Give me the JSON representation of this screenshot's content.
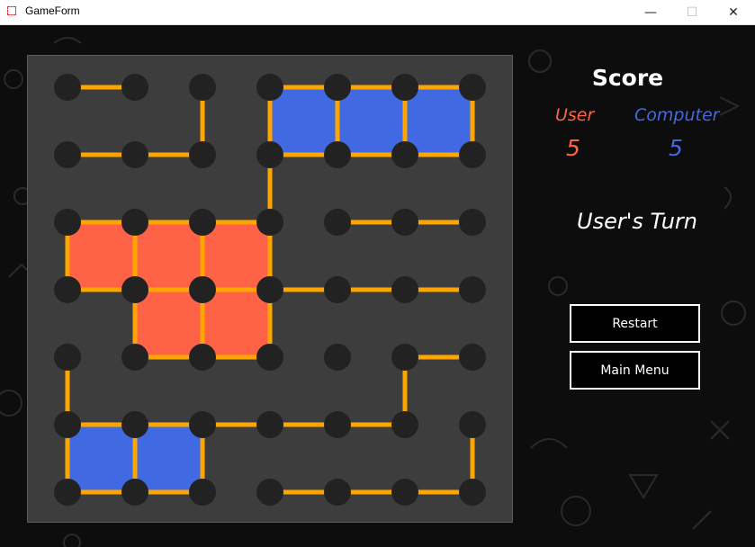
{
  "window": {
    "title": "GameForm",
    "minimize_glyph": "—",
    "maximize_glyph": "☐",
    "close_glyph": "✕"
  },
  "colors": {
    "user": "#ff6347",
    "computer": "#4169e1",
    "line": "#ffa500",
    "dot": "#222222",
    "board": "#3d3d3d"
  },
  "score": {
    "title": "Score",
    "user_label": "User",
    "computer_label": "Computer",
    "user_score": "5",
    "computer_score": "5"
  },
  "turn_text": "User's Turn",
  "buttons": {
    "restart": "Restart",
    "main_menu": "Main Menu"
  },
  "board": {
    "rows": 7,
    "cols": 7,
    "h_lines": [
      [
        0,
        0
      ],
      [
        1,
        0
      ],
      [
        1,
        1
      ],
      [
        0,
        3
      ],
      [
        0,
        4
      ],
      [
        0,
        5
      ],
      [
        1,
        3
      ],
      [
        1,
        4
      ],
      [
        1,
        5
      ],
      [
        2,
        0
      ],
      [
        2,
        1
      ],
      [
        2,
        2
      ],
      [
        2,
        4
      ],
      [
        2,
        5
      ],
      [
        3,
        0
      ],
      [
        3,
        1
      ],
      [
        3,
        2
      ],
      [
        3,
        3
      ],
      [
        3,
        4
      ],
      [
        3,
        5
      ],
      [
        4,
        1
      ],
      [
        4,
        2
      ],
      [
        4,
        5
      ],
      [
        5,
        0
      ],
      [
        5,
        1
      ],
      [
        5,
        2
      ],
      [
        5,
        3
      ],
      [
        5,
        4
      ],
      [
        6,
        0
      ],
      [
        6,
        1
      ],
      [
        6,
        3
      ],
      [
        6,
        4
      ],
      [
        6,
        5
      ]
    ],
    "v_lines": [
      [
        0,
        2
      ],
      [
        0,
        3
      ],
      [
        0,
        4
      ],
      [
        0,
        5
      ],
      [
        0,
        6
      ],
      [
        1,
        3
      ],
      [
        2,
        0
      ],
      [
        2,
        1
      ],
      [
        2,
        2
      ],
      [
        2,
        3
      ],
      [
        3,
        1
      ],
      [
        3,
        2
      ],
      [
        3,
        3
      ],
      [
        4,
        0
      ],
      [
        4,
        5
      ],
      [
        5,
        0
      ],
      [
        5,
        1
      ],
      [
        5,
        2
      ],
      [
        5,
        6
      ]
    ],
    "boxes": [
      {
        "row": 0,
        "col": 3,
        "owner": "computer"
      },
      {
        "row": 0,
        "col": 4,
        "owner": "computer"
      },
      {
        "row": 0,
        "col": 5,
        "owner": "computer"
      },
      {
        "row": 2,
        "col": 0,
        "owner": "user"
      },
      {
        "row": 2,
        "col": 1,
        "owner": "user"
      },
      {
        "row": 2,
        "col": 2,
        "owner": "user"
      },
      {
        "row": 3,
        "col": 1,
        "owner": "user"
      },
      {
        "row": 3,
        "col": 2,
        "owner": "user"
      },
      {
        "row": 5,
        "col": 0,
        "owner": "computer"
      },
      {
        "row": 5,
        "col": 1,
        "owner": "computer"
      }
    ]
  }
}
